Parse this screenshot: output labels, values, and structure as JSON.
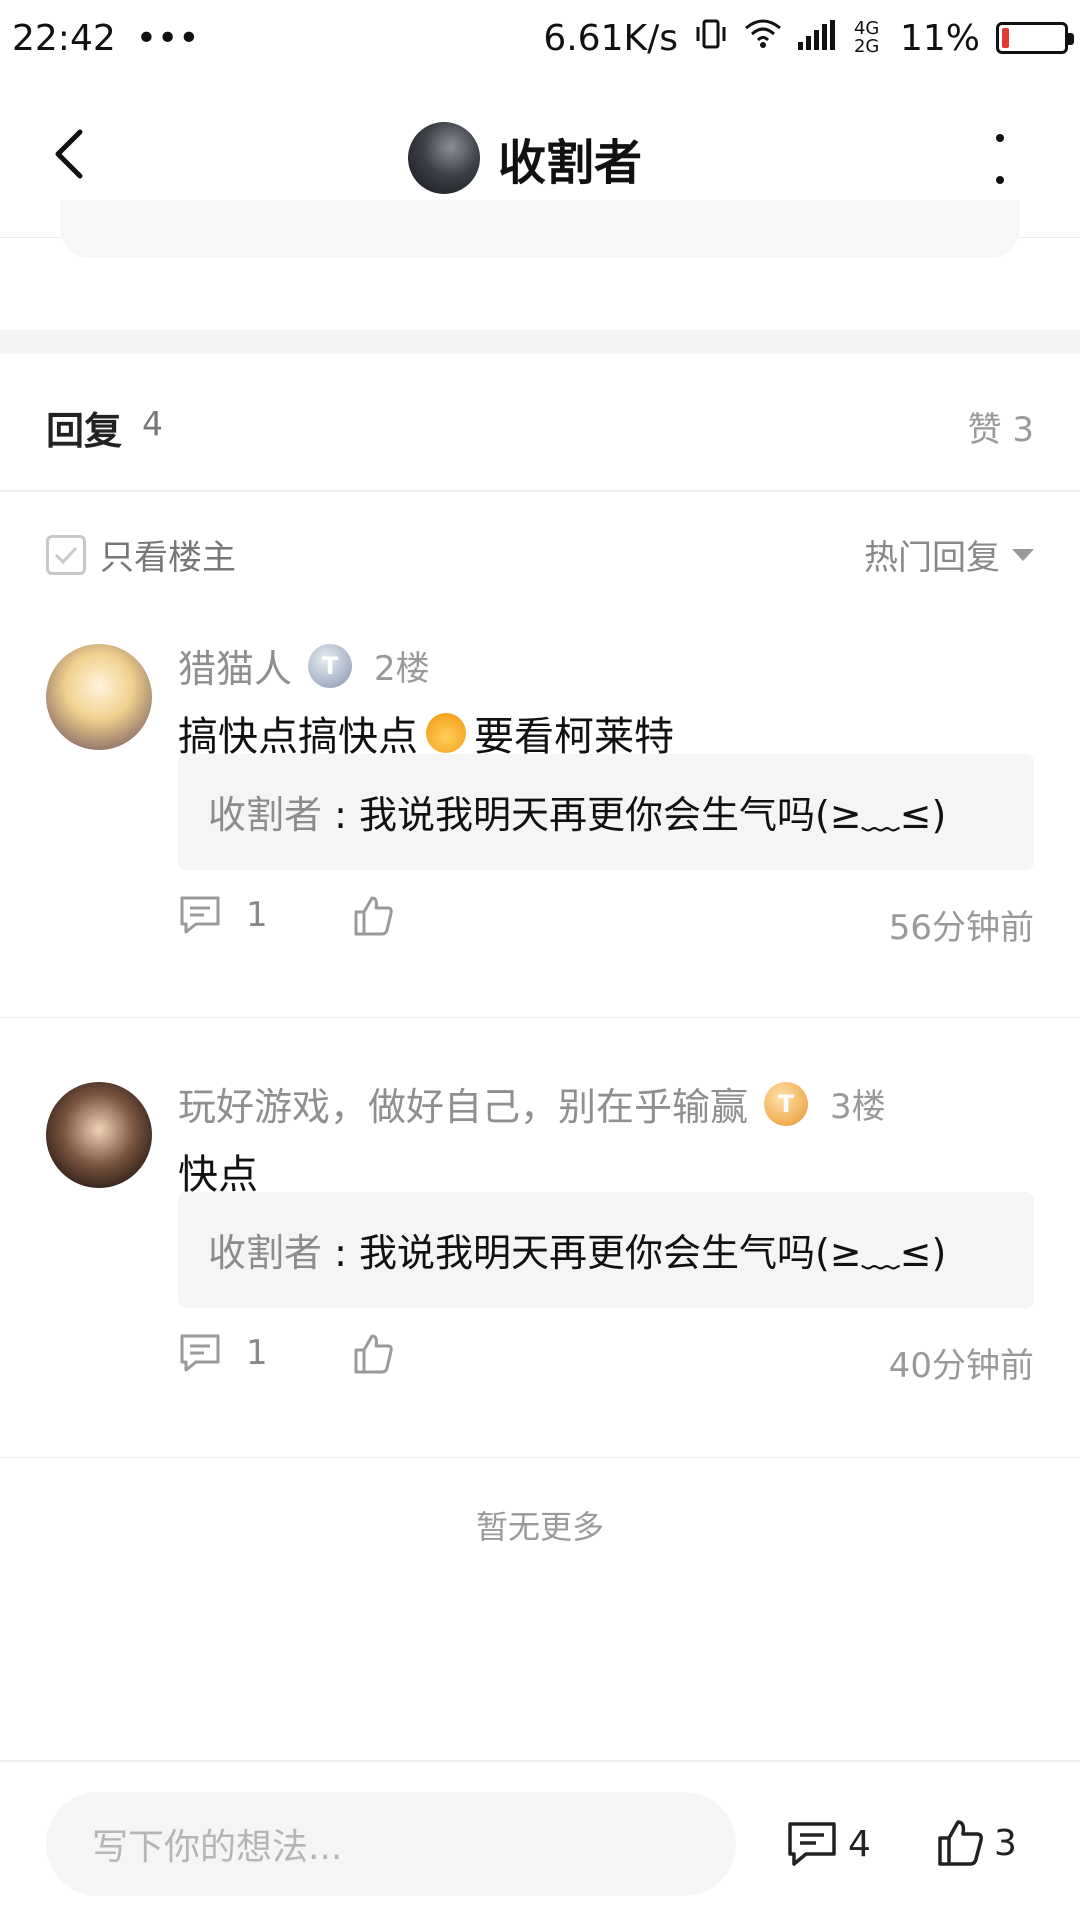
{
  "status_bar": {
    "time": "22:42",
    "dots": "•••",
    "speed": "6.61K/s",
    "network": "4G 2G",
    "battery_percent": "11%",
    "battery_level": 0.11
  },
  "header": {
    "title": "收割者"
  },
  "replies": {
    "label": "回复",
    "count": "4",
    "like_label": "赞 3"
  },
  "filters": {
    "only_op": "只看楼主",
    "sort": "热门回复"
  },
  "comments": [
    {
      "user": "猎猫人",
      "level": "T",
      "floor": "2楼",
      "text_before": "搞快点搞快点",
      "text_after": "要看柯莱特",
      "quote_author": "收割者",
      "quote_sep": " : ",
      "quote_text": "我说我明天再更你会生气吗(≥﹏≤)",
      "reply_count": "1",
      "time": "56分钟前"
    },
    {
      "user": "玩好游戏，做好自己，别在乎输赢",
      "level": "T",
      "floor": "3楼",
      "text": "快点",
      "quote_author": "收割者",
      "quote_sep": " : ",
      "quote_text": "我说我明天再更你会生气吗(≥﹏≤)",
      "reply_count": "1",
      "time": "40分钟前"
    }
  ],
  "footer": {
    "no_more": "暂无更多",
    "input_placeholder": "写下你的想法...",
    "comment_count": "4",
    "like_count": "3"
  }
}
